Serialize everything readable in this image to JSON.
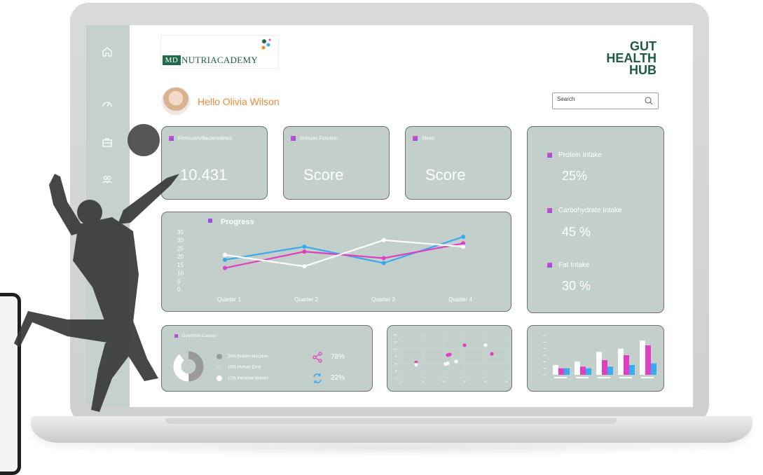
{
  "brand": {
    "logo_prefix": "MD",
    "logo_name": "NUTRIACADEMY",
    "hub_title_lines": [
      "GUT",
      "HEALTH",
      "HUB"
    ]
  },
  "user": {
    "greeting": "Hello Olivia Wilson"
  },
  "search": {
    "placeholder": "Search"
  },
  "sidebar": {
    "icons": [
      "home-icon",
      "dashboard-icon",
      "briefcase-icon",
      "people-icon"
    ]
  },
  "metrics": [
    {
      "label": "Firmicutes/Bacteroidetes",
      "value": "10.431"
    },
    {
      "label": "Immune Function",
      "value": "Score"
    },
    {
      "label": "Sleep",
      "value": "Score"
    }
  ],
  "macros": [
    {
      "label": "Protein Intake",
      "value": "25%"
    },
    {
      "label": "Carbohydrate Intake",
      "value": "45 %"
    },
    {
      "label": "Fat Intake",
      "value": "30 %"
    }
  ],
  "downtime": {
    "title": "Downtime Causes",
    "legend": [
      "25% Broken Machine",
      "15% Human Error",
      "12% Personal Breaks"
    ],
    "stat_share": "78%",
    "stat_refresh": "22%",
    "colors": [
      "#9a9a9a",
      "#c9d3cf",
      "#ffffff"
    ]
  },
  "colors": {
    "blue": "#39a9f0",
    "magenta": "#e03fc2",
    "white": "#ffffff",
    "card": "#c3cfca",
    "accent_orange": "#f0883a",
    "brand_green": "#1f5a45"
  },
  "chart_data": [
    {
      "type": "line",
      "title": "Progress",
      "categories": [
        "Quarter 1",
        "Quarter 2",
        "Quarter 3",
        "Quarter 4"
      ],
      "y_ticks": [
        35,
        30,
        25,
        20,
        15,
        10,
        5,
        0
      ],
      "ylim": [
        0,
        35
      ],
      "series": [
        {
          "color": "#39a9f0",
          "values": [
            18,
            26,
            16,
            32
          ]
        },
        {
          "color": "#e03fc2",
          "values": [
            13,
            23,
            19,
            28
          ]
        },
        {
          "color": "#ffffff",
          "values": [
            21,
            14,
            30,
            26
          ]
        }
      ]
    },
    {
      "type": "scatter",
      "series": [
        {
          "color": "#e03fc2",
          "points": [
            [
              7,
              52
            ],
            [
              22,
              78
            ],
            [
              23,
              80
            ],
            [
              30,
              112
            ],
            [
              43,
              82
            ]
          ]
        },
        {
          "color": "#ffffff",
          "points": [
            [
              7,
              45
            ],
            [
              21,
              47
            ],
            [
              22,
              49
            ],
            [
              26,
              56
            ],
            [
              40,
              112
            ]
          ]
        }
      ],
      "xlim": [
        0,
        50
      ],
      "ylim": [
        0,
        150
      ]
    },
    {
      "type": "bar",
      "series": [
        {
          "color": "#ffffff",
          "values": [
            6,
            8,
            14,
            16,
            21
          ]
        },
        {
          "color": "#e03fc2",
          "values": [
            4,
            5,
            9,
            12,
            18
          ]
        },
        {
          "color": "#39a9f0",
          "values": [
            4,
            4,
            5,
            6,
            7
          ]
        }
      ]
    }
  ]
}
